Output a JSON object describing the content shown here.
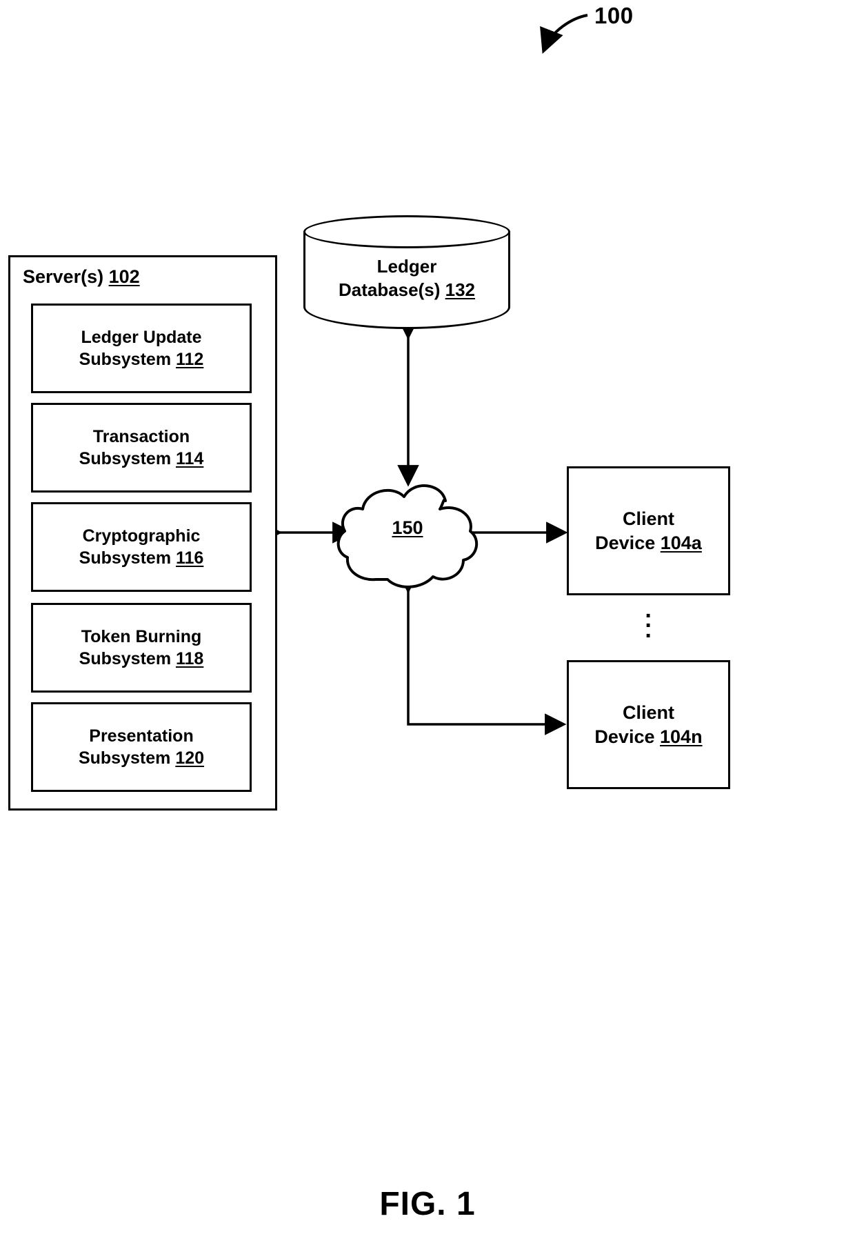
{
  "figure": {
    "number_callout": "100",
    "caption": "FIG. 1"
  },
  "server": {
    "title_text": "Server(s)",
    "title_ref": "102",
    "subsystems": [
      {
        "line1": "Ledger Update",
        "line2": "Subsystem",
        "ref": "112"
      },
      {
        "line1": "Transaction",
        "line2": "Subsystem",
        "ref": "114"
      },
      {
        "line1": "Cryptographic",
        "line2": "Subsystem",
        "ref": "116"
      },
      {
        "line1": "Token Burning",
        "line2": "Subsystem",
        "ref": "118"
      },
      {
        "line1": "Presentation",
        "line2": "Subsystem",
        "ref": "120"
      }
    ]
  },
  "database": {
    "line1": "Ledger",
    "line2": "Database(s)",
    "ref": "132"
  },
  "network": {
    "ref": "150"
  },
  "clients": [
    {
      "line1": "Client",
      "line2": "Device",
      "ref": "104a"
    },
    {
      "line1": "Client",
      "line2": "Device",
      "ref": "104n"
    }
  ],
  "ellipsis": "·",
  "colors": {
    "stroke": "#000000",
    "background": "#ffffff"
  }
}
